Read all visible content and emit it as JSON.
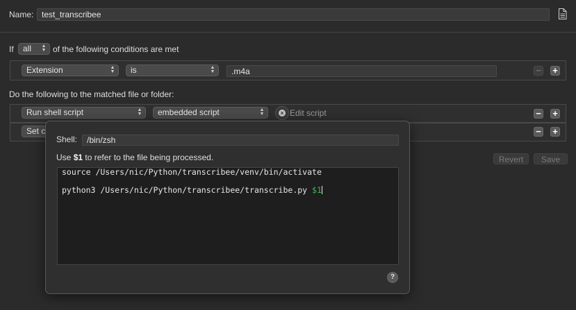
{
  "header": {
    "name_label": "Name:",
    "name_value": "test_transcribee",
    "doc_icon": "document-icon"
  },
  "conditions": {
    "prefix": "If",
    "match_mode": "all",
    "suffix": "of the following conditions are met",
    "rules": [
      {
        "attribute": "Extension",
        "operator": "is",
        "value": ".m4a"
      }
    ]
  },
  "actions": {
    "heading": "Do the following to the matched file or folder:",
    "items": [
      {
        "action": "Run shell script",
        "source": "embedded script",
        "link": "Edit script"
      },
      {
        "action": "Set co"
      }
    ]
  },
  "buttons": {
    "revert": "Revert",
    "save": "Save"
  },
  "script_editor": {
    "shell_label": "Shell:",
    "shell_value": "/bin/zsh",
    "hint_prefix": "Use ",
    "hint_bold": "$1",
    "hint_suffix": " to refer to the file being processed.",
    "code": {
      "line1": "source /Users/nic/Python/transcribee/venv/bin/activate",
      "line3_text": "python3 /Users/nic/Python/transcribee/transcribe.py ",
      "line3_var": "$1"
    },
    "help": "?"
  },
  "colors": {
    "background": "#2b2b2b",
    "code_variable": "#3fb650"
  }
}
